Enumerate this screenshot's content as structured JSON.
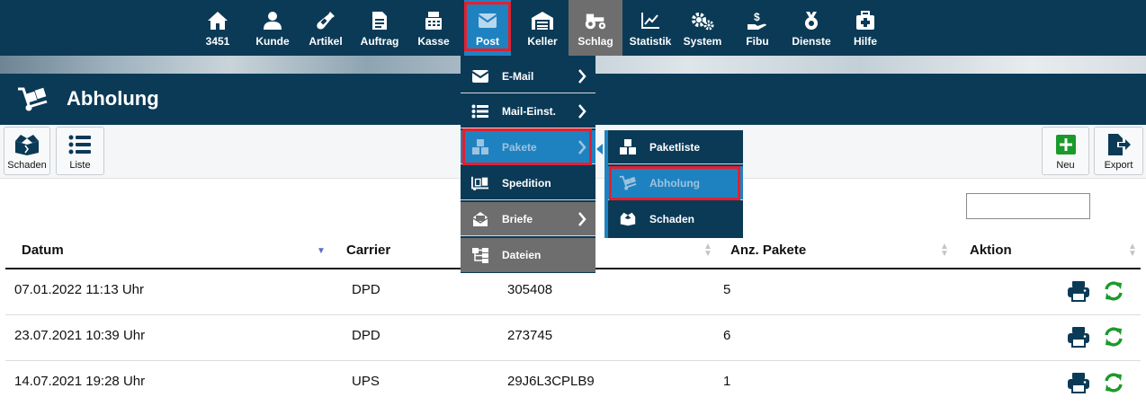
{
  "nav": {
    "items": [
      {
        "label": "3451",
        "icon": "home-icon"
      },
      {
        "label": "Kunde",
        "icon": "user-icon"
      },
      {
        "label": "Artikel",
        "icon": "bottle-icon"
      },
      {
        "label": "Auftrag",
        "icon": "document-icon"
      },
      {
        "label": "Kasse",
        "icon": "cash-register-icon"
      },
      {
        "label": "Post",
        "icon": "envelope-icon"
      },
      {
        "label": "Keller",
        "icon": "warehouse-icon"
      },
      {
        "label": "Schlag",
        "icon": "tractor-icon"
      },
      {
        "label": "Statistik",
        "icon": "line-chart-icon"
      },
      {
        "label": "System",
        "icon": "cogs-icon"
      },
      {
        "label": "Fibu",
        "icon": "hand-dollar-icon"
      },
      {
        "label": "Dienste",
        "icon": "medal-icon"
      },
      {
        "label": "Hilfe",
        "icon": "first-aid-icon"
      }
    ],
    "active": "Post"
  },
  "page": {
    "title": "Abholung",
    "icon": "dolly-icon"
  },
  "toolbar": {
    "left": [
      {
        "label": "Schaden",
        "icon": "broken-box-icon"
      },
      {
        "label": "Liste",
        "icon": "list-icon"
      }
    ],
    "right": [
      {
        "label": "Neu",
        "icon": "plus-icon"
      },
      {
        "label": "Export",
        "icon": "export-icon"
      }
    ]
  },
  "search": {
    "value": "",
    "placeholder": ""
  },
  "table": {
    "columns": [
      "Datum",
      "Carrier",
      "",
      "Anz. Pakete",
      "Aktion"
    ],
    "sorted_column": "Datum",
    "rows": [
      {
        "datum": "07.01.2022 11:13 Uhr",
        "carrier": "DPD",
        "nr": "305408",
        "anz": "5"
      },
      {
        "datum": "23.07.2021 10:39 Uhr",
        "carrier": "DPD",
        "nr": "273745",
        "anz": "6"
      },
      {
        "datum": "14.07.2021 19:28 Uhr",
        "carrier": "UPS",
        "nr": "29J6L3CPLB9",
        "anz": "1"
      }
    ],
    "row_actions": [
      "print-icon",
      "refresh-icon"
    ]
  },
  "post_menu": {
    "items": [
      {
        "label": "E-Mail",
        "icon": "envelope-icon",
        "has_submenu": true
      },
      {
        "label": "Mail-Einst.",
        "icon": "mail-settings-icon",
        "has_submenu": true
      },
      {
        "label": "Pakete",
        "icon": "boxes-icon",
        "has_submenu": true
      },
      {
        "label": "Spedition",
        "icon": "truck-loading-icon",
        "has_submenu": false
      },
      {
        "label": "Briefe",
        "icon": "letter-icon",
        "has_submenu": true
      },
      {
        "label": "Dateien",
        "icon": "sitemap-icon",
        "has_submenu": false
      }
    ],
    "active": "Pakete"
  },
  "pakete_submenu": {
    "items": [
      {
        "label": "Paketliste",
        "icon": "boxes-icon"
      },
      {
        "label": "Abholung",
        "icon": "dolly-icon"
      },
      {
        "label": "Schaden",
        "icon": "broken-box-icon"
      }
    ],
    "active": "Abholung"
  },
  "colors": {
    "nav_bg": "#0b3a57",
    "active_blue": "#1e82c1",
    "highlight_red": "#e2202f",
    "action_green": "#1a9a2a"
  }
}
